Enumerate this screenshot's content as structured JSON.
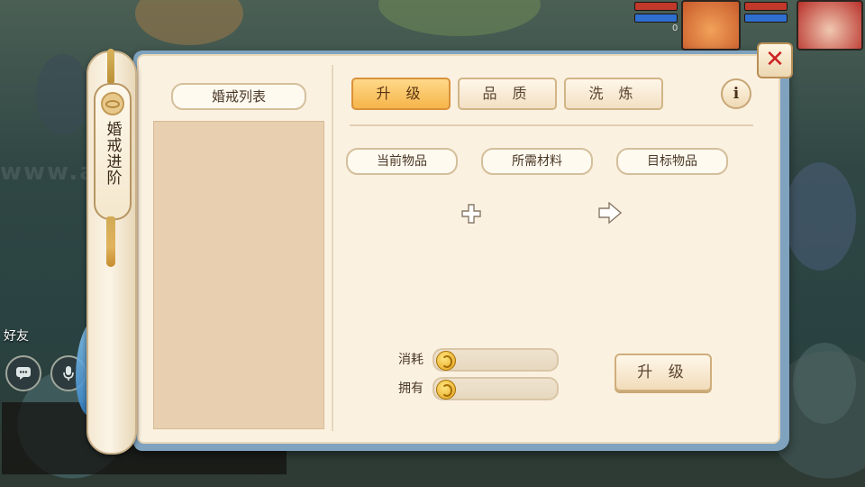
{
  "window": {
    "side_tag": "婚戒进阶",
    "close_icon": "close-icon"
  },
  "left_panel": {
    "title": "婚戒列表"
  },
  "tabs": [
    {
      "label": "升 级",
      "active": true
    },
    {
      "label": "品 质",
      "active": false
    },
    {
      "label": "洗 炼",
      "active": false
    }
  ],
  "info_icon_glyph": "i",
  "slots": {
    "current": "当前物品",
    "materials": "所需材料",
    "target": "目标物品"
  },
  "resources": {
    "cost_label": "消耗",
    "cost_value": "",
    "owned_label": "拥有",
    "owned_value": ""
  },
  "upgrade_button": "升 级",
  "hud": {
    "friends_label": "好友",
    "hero_count": "0",
    "watermark": "www.aae.ink"
  },
  "colors": {
    "tab_active": "#f6b54a",
    "panel_bg": "#fbf1e1",
    "close_x": "#cc2222"
  }
}
